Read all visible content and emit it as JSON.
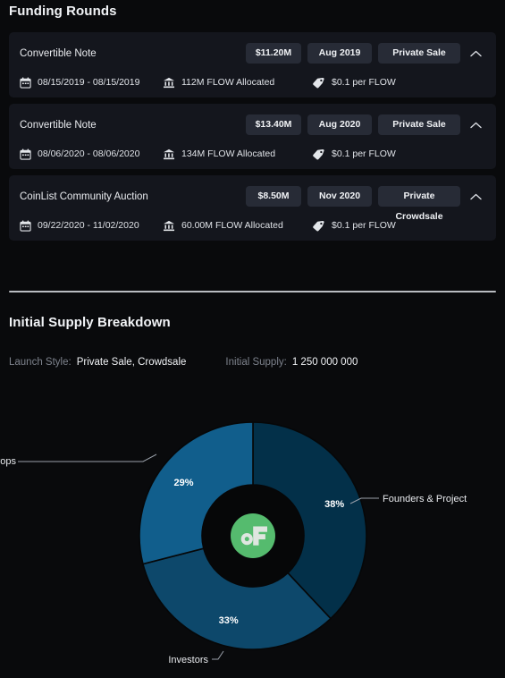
{
  "funding": {
    "title": "Funding Rounds",
    "rounds": [
      {
        "name": "Convertible Note",
        "amount": "$11.20M",
        "date": "Aug 2019",
        "type": "Private Sale",
        "toggle_icon": "chevron-up-icon",
        "date_range": "08/15/2019 - 08/15/2019",
        "allocation": "112M FLOW Allocated",
        "price": "$0.1 per FLOW",
        "date_icon": "calendar-icon",
        "alloc_icon": "bank-icon",
        "price_icon": "tag-icon"
      },
      {
        "name": "Convertible Note",
        "amount": "$13.40M",
        "date": "Aug 2020",
        "type": "Private Sale",
        "toggle_icon": "chevron-up-icon",
        "date_range": "08/06/2020 - 08/06/2020",
        "allocation": "134M FLOW Allocated",
        "price": "$0.1 per FLOW",
        "date_icon": "calendar-icon",
        "alloc_icon": "bank-icon",
        "price_icon": "tag-icon"
      },
      {
        "name": "CoinList Community Auction",
        "amount": "$8.50M",
        "date": "Nov 2020",
        "type": "Private Crowdsale",
        "toggle_icon": "chevron-up-icon",
        "date_range": "09/22/2020 - 11/02/2020",
        "allocation": "60.00M FLOW Allocated",
        "price": "$0.1 per FLOW",
        "date_icon": "calendar-icon",
        "alloc_icon": "bank-icon",
        "price_icon": "tag-icon"
      }
    ]
  },
  "supply": {
    "title": "Initial Supply Breakdown",
    "launch_style_label": "Launch Style:",
    "launch_style_value": "Private Sale, Crowdsale",
    "initial_supply_label": "Initial Supply:",
    "initial_supply_value": "1 250 000 000",
    "center_icon": "flow-logo-icon"
  },
  "chart_data": {
    "type": "pie",
    "title": "Initial Supply Breakdown",
    "variant": "donut",
    "legend": "callout-labels",
    "unit": "%",
    "categories": [
      "Founders & Project",
      "Investors",
      "Premined Rewards & Airdrops"
    ],
    "values": [
      38,
      33,
      29
    ],
    "labels": [
      "38%",
      "33%",
      "29%"
    ],
    "colors": [
      "#033049",
      "#0d486b",
      "#115e8c"
    ],
    "center_logo_color": "#55bb6e",
    "start_angle_deg": 0,
    "direction": "clockwise"
  },
  "colors": {
    "page_bg": "#090a0c",
    "card_bg": "#14161d",
    "pill_bg": "#272b36",
    "divider": "#b9bcc1",
    "text_primary": "#f0f2f5",
    "text_muted": "#7d828c",
    "accent_green": "#55bb6e"
  }
}
